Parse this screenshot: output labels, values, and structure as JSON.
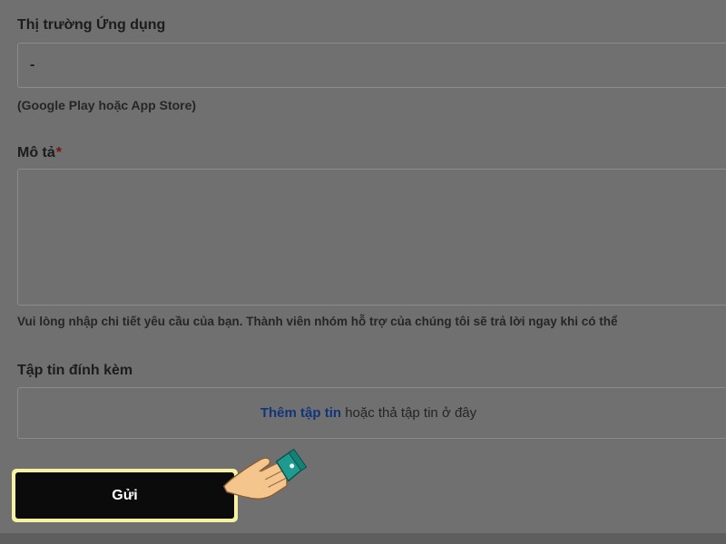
{
  "form": {
    "market": {
      "label": "Thị trường Ứng dụng",
      "value": "-",
      "hint": "(Google Play hoặc App Store)"
    },
    "description": {
      "label": "Mô tả",
      "required_mark": "*",
      "value": "",
      "hint": "Vui lòng nhập chi tiết yêu cầu của bạn. Thành viên nhóm hỗ trợ của chúng tôi sẽ trả lời ngay khi có thể"
    },
    "attachments": {
      "label": "Tập tin đính kèm",
      "add_link": "Thêm tập tin",
      "drop_text": " hoặc thả tập tin ở đây"
    },
    "submit_label": "Gửi"
  },
  "colors": {
    "overlay_background": "#707070",
    "submit_background": "#0b0b0b",
    "submit_highlight": "#f7f2a0",
    "link": "#12357a",
    "required": "#7a1212"
  },
  "icons": {
    "pointer": "pointing-hand-icon"
  }
}
